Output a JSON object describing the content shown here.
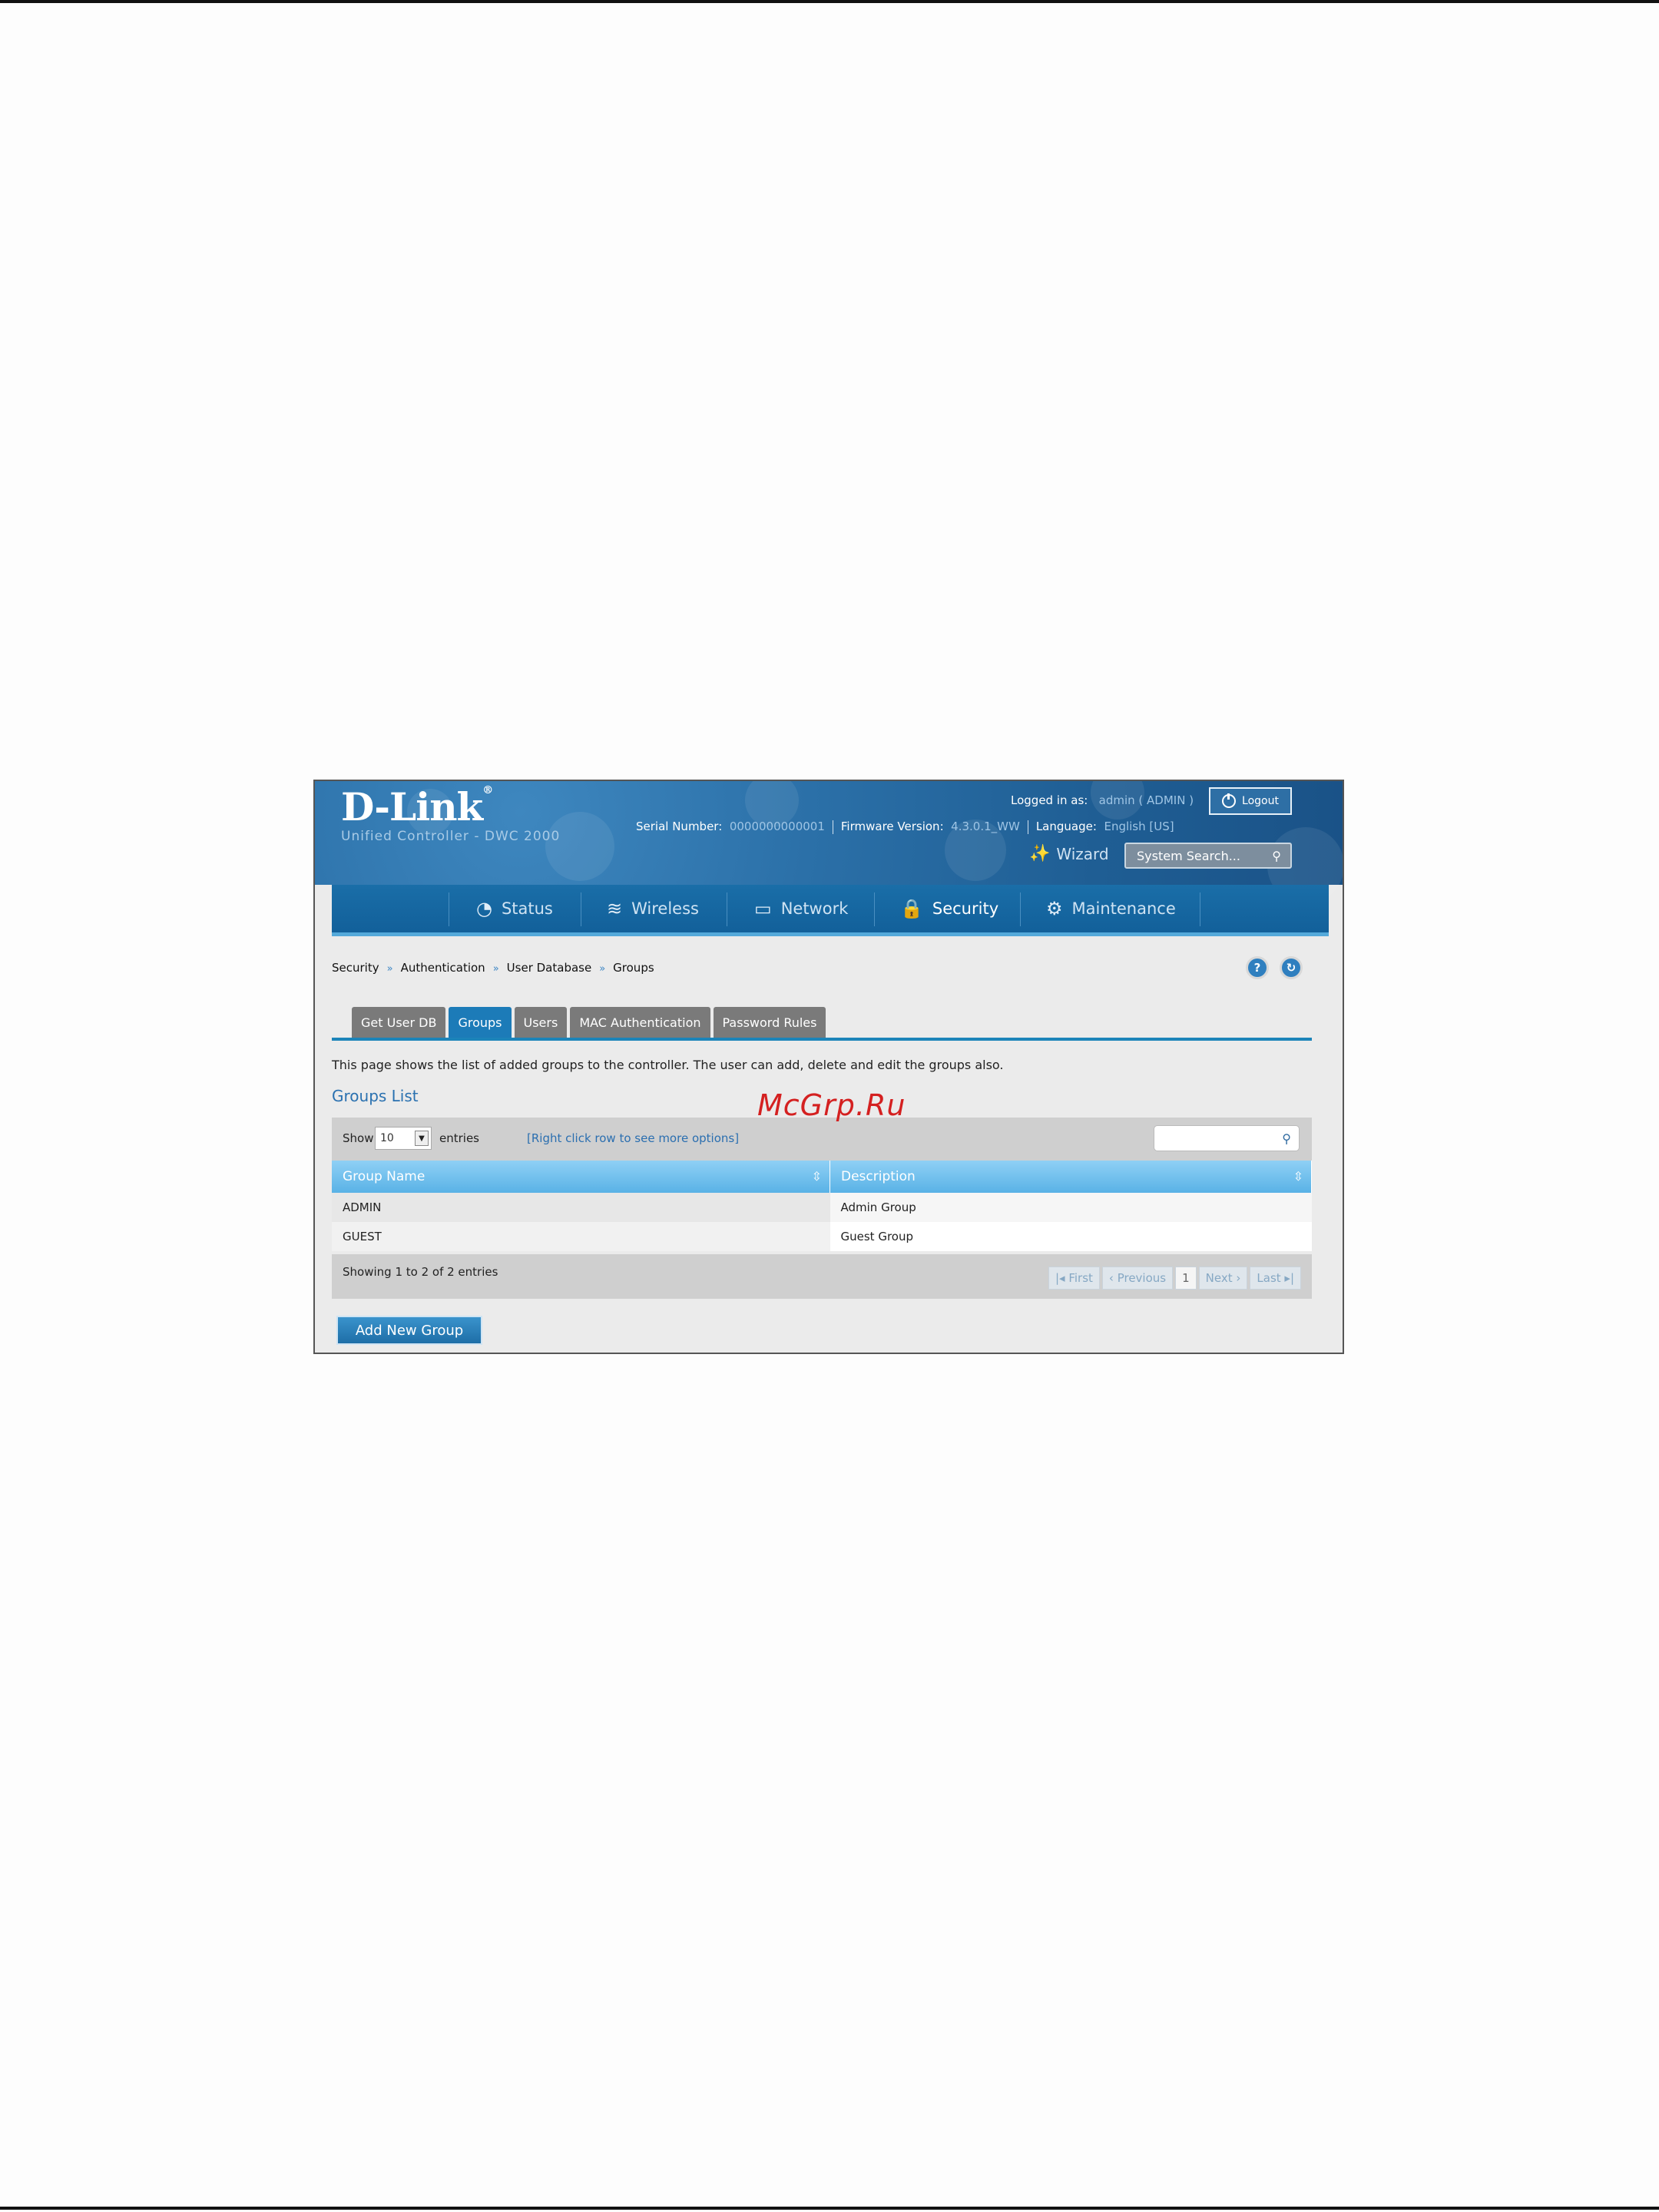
{
  "watermark": "McGrp.Ru",
  "header": {
    "logo": "D-Link",
    "logo_mark": "®",
    "subtitle": "Unified Controller - DWC 2000",
    "logged_in_label": "Logged in as:",
    "logged_in_value": "admin ( ADMIN )",
    "logout_label": "Logout",
    "serial_label": "Serial Number:",
    "serial_value": "0000000000001",
    "firmware_label": "Firmware Version:",
    "firmware_value": "4.3.0.1_WW",
    "language_label": "Language:",
    "language_value": "English [US]",
    "wizard_label": "Wizard",
    "search_placeholder": "System Search..."
  },
  "nav": {
    "items": [
      {
        "label": "Status",
        "icon": "gauge-icon"
      },
      {
        "label": "Wireless",
        "icon": "wifi-icon"
      },
      {
        "label": "Network",
        "icon": "monitor-icon"
      },
      {
        "label": "Security",
        "icon": "lock-icon",
        "active": true
      },
      {
        "label": "Maintenance",
        "icon": "gears-icon"
      }
    ]
  },
  "breadcrumb": [
    "Security",
    "Authentication",
    "User Database",
    "Groups"
  ],
  "tabs": [
    {
      "label": "Get User DB"
    },
    {
      "label": "Groups",
      "active": true
    },
    {
      "label": "Users"
    },
    {
      "label": "MAC Authentication"
    },
    {
      "label": "Password Rules"
    }
  ],
  "page": {
    "description": "This page shows the list of added groups to the controller. The user can add, delete and edit the groups also.",
    "section_title": "Groups List"
  },
  "table": {
    "show_label": "Show",
    "entries_value": "10",
    "entries_label": "entries",
    "hint": "[Right click row to see more options]",
    "columns": [
      "Group Name",
      "Description"
    ],
    "rows": [
      [
        "ADMIN",
        "Admin Group"
      ],
      [
        "GUEST",
        "Guest Group"
      ]
    ],
    "showing": "Showing 1 to 2 of 2 entries",
    "pager": {
      "first": "First",
      "previous": "Previous",
      "page": "1",
      "next": "Next",
      "last": "Last"
    }
  },
  "add_button": "Add New Group"
}
